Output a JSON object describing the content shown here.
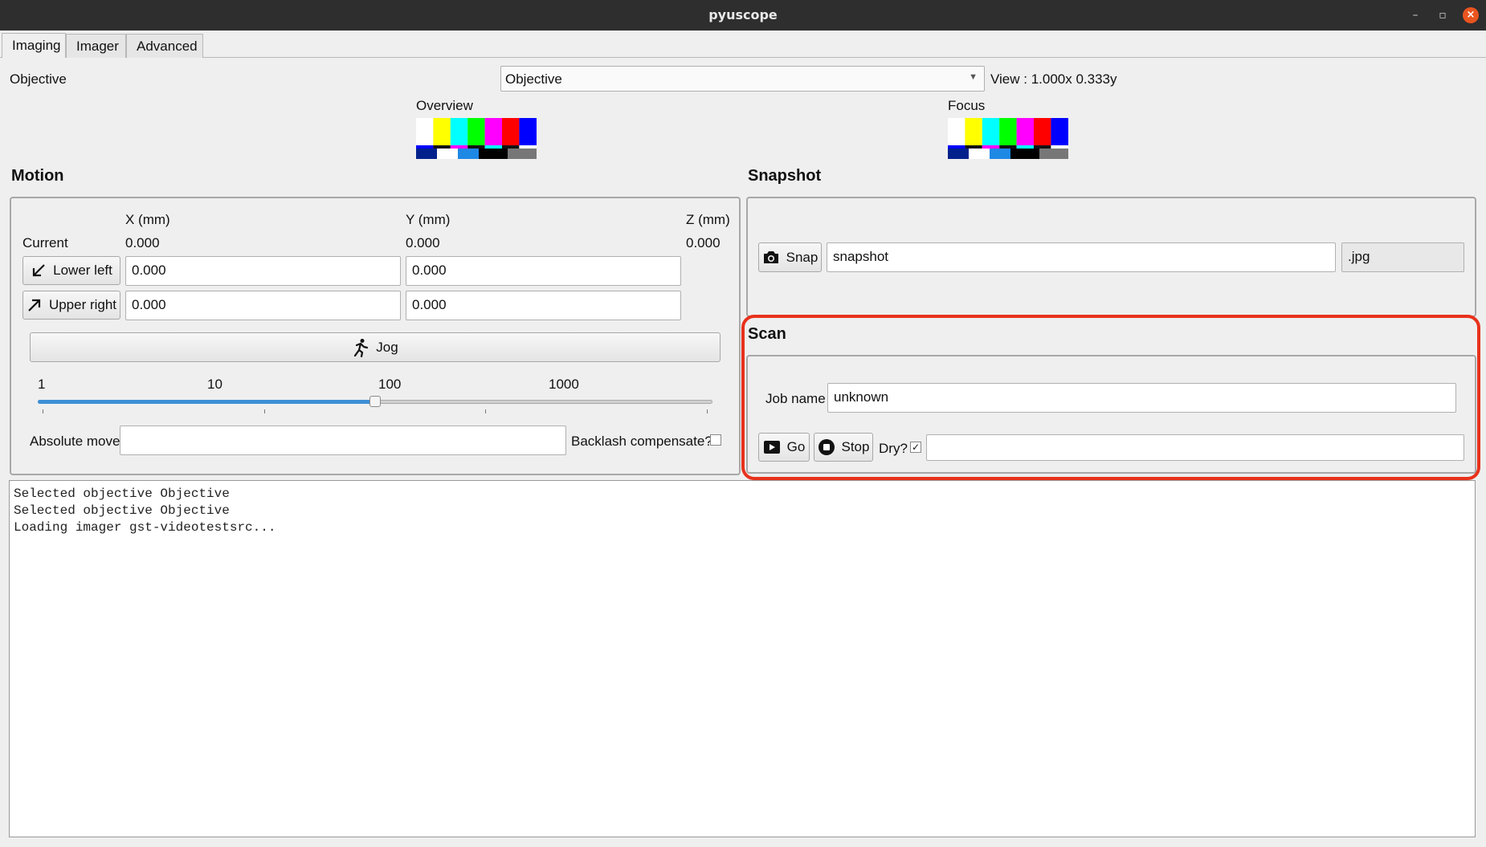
{
  "window": {
    "title": "pyuscope"
  },
  "tabs": [
    {
      "label": "Imaging",
      "active": true
    },
    {
      "label": "Imager",
      "active": false
    },
    {
      "label": "Advanced",
      "active": false
    }
  ],
  "objective": {
    "label": "Objective",
    "selected": "Objective",
    "view": "View : 1.000x 0.333y"
  },
  "previews": {
    "overview_label": "Overview",
    "focus_label": "Focus"
  },
  "motion": {
    "heading": "Motion",
    "col_x": "X (mm)",
    "col_y": "Y (mm)",
    "col_z": "Z (mm)",
    "current_label": "Current",
    "current_x": "0.000",
    "current_y": "0.000",
    "current_z": "0.000",
    "lower_left_label": "Lower left",
    "lower_left_x": "0.000",
    "lower_left_y": "0.000",
    "upper_right_label": "Upper right",
    "upper_right_x": "0.000",
    "upper_right_y": "0.000",
    "jog_label": "Jog",
    "slider_ticks": [
      "1",
      "10",
      "100",
      "1000"
    ],
    "slider_value": 100,
    "absolute_move_label": "Absolute move",
    "absolute_move_value": "",
    "backlash_label": "Backlash compensate?",
    "backlash_checked": false
  },
  "snapshot": {
    "heading": "Snapshot",
    "snap_label": "Snap",
    "filename": "snapshot",
    "extension": ".jpg"
  },
  "scan": {
    "heading": "Scan",
    "job_name_label": "Job name",
    "job_name_value": "unknown",
    "go_label": "Go",
    "stop_label": "Stop",
    "dry_label": "Dry?",
    "dry_checked": true,
    "dry_mark": "✓",
    "status_value": ""
  },
  "log": {
    "lines": [
      "Selected objective Objective",
      "Selected objective Objective",
      "Loading imager gst-videotestsrc..."
    ]
  },
  "colors": {
    "highlight": "#e8321c",
    "slider_fill": "#3d8fd6",
    "titlebar": "#2e2e2e",
    "close_button": "#e9541f"
  }
}
